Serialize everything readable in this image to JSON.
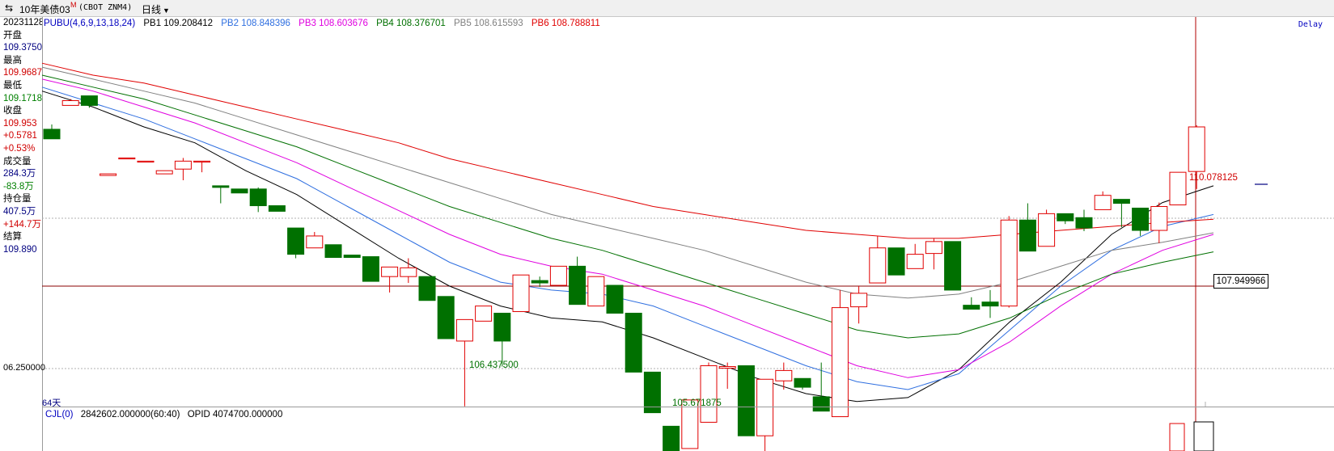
{
  "header": {
    "back_icon": "exchange-arrows-icon",
    "title": "10年美债03",
    "badge": "M",
    "code": "(CBOT ZNM4)",
    "period": "日线"
  },
  "side_panel": {
    "date": "20231128",
    "open_label": "开盘",
    "open": "109.3750",
    "high_label": "最高",
    "high": "109.9687",
    "low_label": "最低",
    "low": "109.1718",
    "close_label": "收盘",
    "close": "109.953",
    "change": "+0.5781",
    "change_pct": "+0.53%",
    "volume_label": "成交量",
    "volume": "284.3万",
    "volume_change": "-83.8万",
    "oi_label": "持仓量",
    "oi": "407.5万",
    "oi_change": "+144.7万",
    "settle_label": "结算",
    "settle": "109.890"
  },
  "legend": {
    "name": "PUBU(4,6,9,13,18,24)",
    "pb1": "PB1 109.208412",
    "pb2": "PB2 108.848396",
    "pb3": "PB3 108.603676",
    "pb4": "PB4 108.376701",
    "pb5": "PB5 108.615593",
    "pb6": "PB6 108.788811"
  },
  "delay": "Delay",
  "labels": {
    "last_high": "110.078125",
    "crosshair_price": "107.949966",
    "low1": "106.437500",
    "low2": "105.671875",
    "y_tick": "06.250000",
    "days": "64天"
  },
  "sub_legend": {
    "name": "CJL(0)",
    "vol": "2842602.000000(60:40)",
    "opid": "OPID 4074700.000000"
  },
  "colors": {
    "up": "#e00000",
    "down": "#007000",
    "pb1": "#000000",
    "pb2": "#2f6fe0",
    "pb3": "#e000e0",
    "pb4": "#007000",
    "pb5": "#808080",
    "pb6": "#e00000"
  },
  "chart_data": {
    "type": "candlestick",
    "y_unit": "price",
    "candles": [
      {
        "o": 109.92,
        "h": 109.98,
        "l": 109.8,
        "c": 109.8
      },
      {
        "o": 110.22,
        "h": 110.3,
        "l": 110.22,
        "c": 110.28
      },
      {
        "o": 110.34,
        "h": 110.34,
        "l": 110.19,
        "c": 110.22
      },
      {
        "o": 109.34,
        "h": 109.36,
        "l": 109.34,
        "c": 109.36
      },
      {
        "o": 109.56,
        "h": 109.56,
        "l": 109.56,
        "c": 109.56
      },
      {
        "o": 109.52,
        "h": 109.52,
        "l": 109.52,
        "c": 109.52
      },
      {
        "o": 109.36,
        "h": 109.4,
        "l": 109.36,
        "c": 109.4
      },
      {
        "o": 109.42,
        "h": 109.56,
        "l": 109.28,
        "c": 109.52
      },
      {
        "o": 109.52,
        "h": 109.52,
        "l": 109.38,
        "c": 109.52
      },
      {
        "o": 109.21,
        "h": 109.21,
        "l": 108.99,
        "c": 109.19
      },
      {
        "o": 109.17,
        "h": 109.17,
        "l": 109.12,
        "c": 109.12
      },
      {
        "o": 109.17,
        "h": 109.19,
        "l": 108.88,
        "c": 108.96
      },
      {
        "o": 108.96,
        "h": 108.96,
        "l": 108.89,
        "c": 108.89
      },
      {
        "o": 108.68,
        "h": 108.68,
        "l": 108.3,
        "c": 108.35
      },
      {
        "o": 108.43,
        "h": 108.63,
        "l": 108.43,
        "c": 108.58
      },
      {
        "o": 108.47,
        "h": 108.47,
        "l": 108.31,
        "c": 108.31
      },
      {
        "o": 108.34,
        "h": 108.34,
        "l": 108.31,
        "c": 108.31
      },
      {
        "o": 108.32,
        "h": 108.32,
        "l": 108.01,
        "c": 108.01
      },
      {
        "o": 108.07,
        "h": 108.19,
        "l": 107.87,
        "c": 108.19
      },
      {
        "o": 108.07,
        "h": 108.3,
        "l": 107.99,
        "c": 108.18
      },
      {
        "o": 108.07,
        "h": 108.07,
        "l": 107.77,
        "c": 107.77
      },
      {
        "o": 107.82,
        "h": 107.82,
        "l": 107.29,
        "c": 107.29
      },
      {
        "o": 107.26,
        "h": 107.53,
        "l": 106.44,
        "c": 107.53
      },
      {
        "o": 107.51,
        "h": 107.7,
        "l": 107.51,
        "c": 107.7
      },
      {
        "o": 107.61,
        "h": 107.61,
        "l": 106.94,
        "c": 107.26
      },
      {
        "o": 107.63,
        "h": 108.09,
        "l": 107.63,
        "c": 108.09
      },
      {
        "o": 108.02,
        "h": 108.07,
        "l": 107.94,
        "c": 107.99
      },
      {
        "o": 107.96,
        "h": 108.2,
        "l": 107.96,
        "c": 108.2
      },
      {
        "o": 108.2,
        "h": 108.32,
        "l": 107.72,
        "c": 107.72
      },
      {
        "o": 107.7,
        "h": 108.07,
        "l": 107.7,
        "c": 108.07
      },
      {
        "o": 107.96,
        "h": 107.96,
        "l": 107.61,
        "c": 107.61
      },
      {
        "o": 107.61,
        "h": 107.61,
        "l": 106.87,
        "c": 106.87
      },
      {
        "o": 106.87,
        "h": 106.87,
        "l": 106.36,
        "c": 106.36
      },
      {
        "o": 106.19,
        "h": 106.19,
        "l": 105.67,
        "c": 105.74
      },
      {
        "o": 105.91,
        "h": 106.52,
        "l": 105.91,
        "c": 106.52
      },
      {
        "o": 106.24,
        "h": 106.99,
        "l": 106.24,
        "c": 106.95
      },
      {
        "o": 106.92,
        "h": 106.99,
        "l": 106.66,
        "c": 106.94
      },
      {
        "o": 106.95,
        "h": 106.95,
        "l": 106.07,
        "c": 106.07
      },
      {
        "o": 106.07,
        "h": 106.78,
        "l": 105.8,
        "c": 106.78
      },
      {
        "o": 106.76,
        "h": 106.99,
        "l": 106.65,
        "c": 106.89
      },
      {
        "o": 106.79,
        "h": 106.79,
        "l": 106.65,
        "c": 106.68
      },
      {
        "o": 106.56,
        "h": 106.99,
        "l": 106.48,
        "c": 106.38
      },
      {
        "o": 106.31,
        "h": 107.9,
        "l": 106.31,
        "c": 107.68
      },
      {
        "o": 107.69,
        "h": 107.95,
        "l": 107.48,
        "c": 107.86
      },
      {
        "o": 107.99,
        "h": 108.58,
        "l": 107.99,
        "c": 108.43
      },
      {
        "o": 108.43,
        "h": 108.43,
        "l": 108.09,
        "c": 108.09
      },
      {
        "o": 108.17,
        "h": 108.48,
        "l": 108.17,
        "c": 108.35
      },
      {
        "o": 108.36,
        "h": 108.55,
        "l": 108.16,
        "c": 108.51
      },
      {
        "o": 108.51,
        "h": 108.51,
        "l": 107.9,
        "c": 107.9
      },
      {
        "o": 107.71,
        "h": 107.81,
        "l": 107.66,
        "c": 107.66
      },
      {
        "o": 107.75,
        "h": 107.9,
        "l": 107.55,
        "c": 107.7
      },
      {
        "o": 107.7,
        "h": 108.83,
        "l": 107.68,
        "c": 108.78
      },
      {
        "o": 108.78,
        "h": 108.99,
        "l": 108.4,
        "c": 108.39
      },
      {
        "o": 108.45,
        "h": 108.91,
        "l": 108.45,
        "c": 108.86
      },
      {
        "o": 108.86,
        "h": 108.86,
        "l": 108.73,
        "c": 108.77
      },
      {
        "o": 108.81,
        "h": 108.91,
        "l": 108.64,
        "c": 108.68
      },
      {
        "o": 108.91,
        "h": 109.14,
        "l": 108.91,
        "c": 109.09
      },
      {
        "o": 109.04,
        "h": 109.04,
        "l": 108.69,
        "c": 108.99
      },
      {
        "o": 108.93,
        "h": 108.93,
        "l": 108.58,
        "c": 108.65
      },
      {
        "o": 108.65,
        "h": 109.0,
        "l": 108.49,
        "c": 108.95
      },
      {
        "o": 108.97,
        "h": 109.38,
        "l": 108.97,
        "c": 109.38
      },
      {
        "o": 109.39,
        "h": 109.97,
        "l": 109.17,
        "c": 109.95
      }
    ],
    "series": [
      {
        "name": "PB1",
        "values": [
          110.4,
          110.2,
          109.95,
          109.75,
          109.4,
          109.1,
          108.7,
          108.3,
          107.95,
          107.7,
          107.55,
          107.5,
          107.3,
          107.05,
          106.8,
          106.6,
          106.5,
          106.55,
          106.9,
          107.5,
          108.0,
          108.6,
          109.0,
          109.21
        ]
      },
      {
        "name": "PB2",
        "values": [
          110.45,
          110.25,
          110.05,
          109.8,
          109.55,
          109.3,
          108.95,
          108.6,
          108.25,
          108.0,
          107.9,
          107.85,
          107.7,
          107.45,
          107.2,
          106.95,
          106.75,
          106.65,
          106.85,
          107.4,
          107.95,
          108.4,
          108.7,
          108.85
        ]
      },
      {
        "name": "PB3",
        "values": [
          110.55,
          110.4,
          110.2,
          110.0,
          109.75,
          109.5,
          109.2,
          108.9,
          108.6,
          108.35,
          108.2,
          108.1,
          107.9,
          107.7,
          107.45,
          107.2,
          106.95,
          106.8,
          106.9,
          107.25,
          107.7,
          108.1,
          108.4,
          108.6
        ]
      },
      {
        "name": "PB4",
        "values": [
          110.6,
          110.45,
          110.3,
          110.1,
          109.9,
          109.7,
          109.45,
          109.2,
          108.95,
          108.75,
          108.55,
          108.4,
          108.2,
          108.0,
          107.8,
          107.6,
          107.4,
          107.3,
          107.35,
          107.55,
          107.85,
          108.1,
          108.25,
          108.38
        ]
      },
      {
        "name": "PB5",
        "values": [
          110.7,
          110.55,
          110.4,
          110.25,
          110.05,
          109.85,
          109.65,
          109.45,
          109.25,
          109.05,
          108.85,
          108.7,
          108.55,
          108.4,
          108.2,
          108.0,
          107.85,
          107.8,
          107.85,
          108.0,
          108.2,
          108.4,
          108.5,
          108.62
        ]
      },
      {
        "name": "PB6",
        "values": [
          110.75,
          110.6,
          110.5,
          110.35,
          110.2,
          110.05,
          109.9,
          109.75,
          109.55,
          109.4,
          109.25,
          109.1,
          108.95,
          108.85,
          108.75,
          108.65,
          108.6,
          108.55,
          108.55,
          108.6,
          108.65,
          108.7,
          108.75,
          108.79
        ]
      }
    ]
  }
}
